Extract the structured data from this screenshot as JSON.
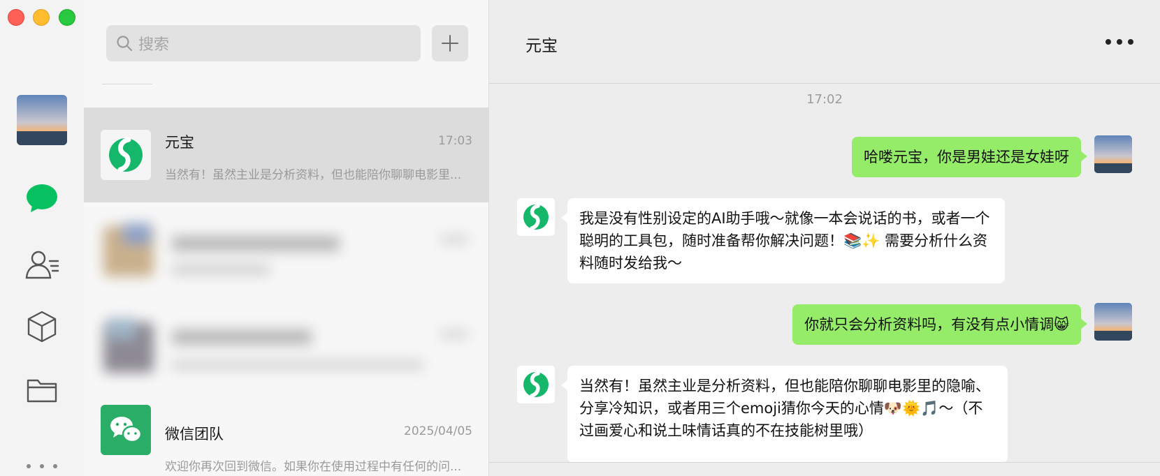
{
  "window": {
    "controls": [
      "close",
      "minimize",
      "maximize"
    ]
  },
  "rail": {
    "icons": [
      "chats-icon",
      "contacts-icon",
      "mini-programs-icon",
      "files-icon",
      "more-icon"
    ],
    "accent": "#07c160"
  },
  "search": {
    "placeholder": "搜索"
  },
  "chat_list": [
    {
      "name": "元宝",
      "time": "17:03",
      "preview": "当然有！虽然主业是分析资料，但也能陪你聊聊电影里...",
      "active": true
    },
    {
      "name": "微信团队",
      "time": "2025/04/05",
      "preview": "欢迎你再次回到微信。如果你在使用过程中有任何的问...",
      "active": false
    }
  ],
  "conversation": {
    "title": "元宝",
    "timestamp": "17:02",
    "messages": [
      {
        "from": "me",
        "text": "哈喽元宝，你是男娃还是女娃呀"
      },
      {
        "from": "them",
        "text": "我是没有性别设定的AI助手哦～就像一本会说话的书，或者一个聪明的工具包，随时准备帮你解决问题！📚✨ 需要分析什么资料随时发给我～"
      },
      {
        "from": "me",
        "text": "你就只会分析资料吗，有没有点小情调😸"
      },
      {
        "from": "them",
        "text": "当然有！虽然主业是分析资料，但也能陪你聊聊电影里的隐喻、分享冷知识，或者用三个emoji猜你今天的心情🐶🌞🎵～（不过画爱心和说土味情话真的不在技能树里哦）"
      }
    ]
  }
}
